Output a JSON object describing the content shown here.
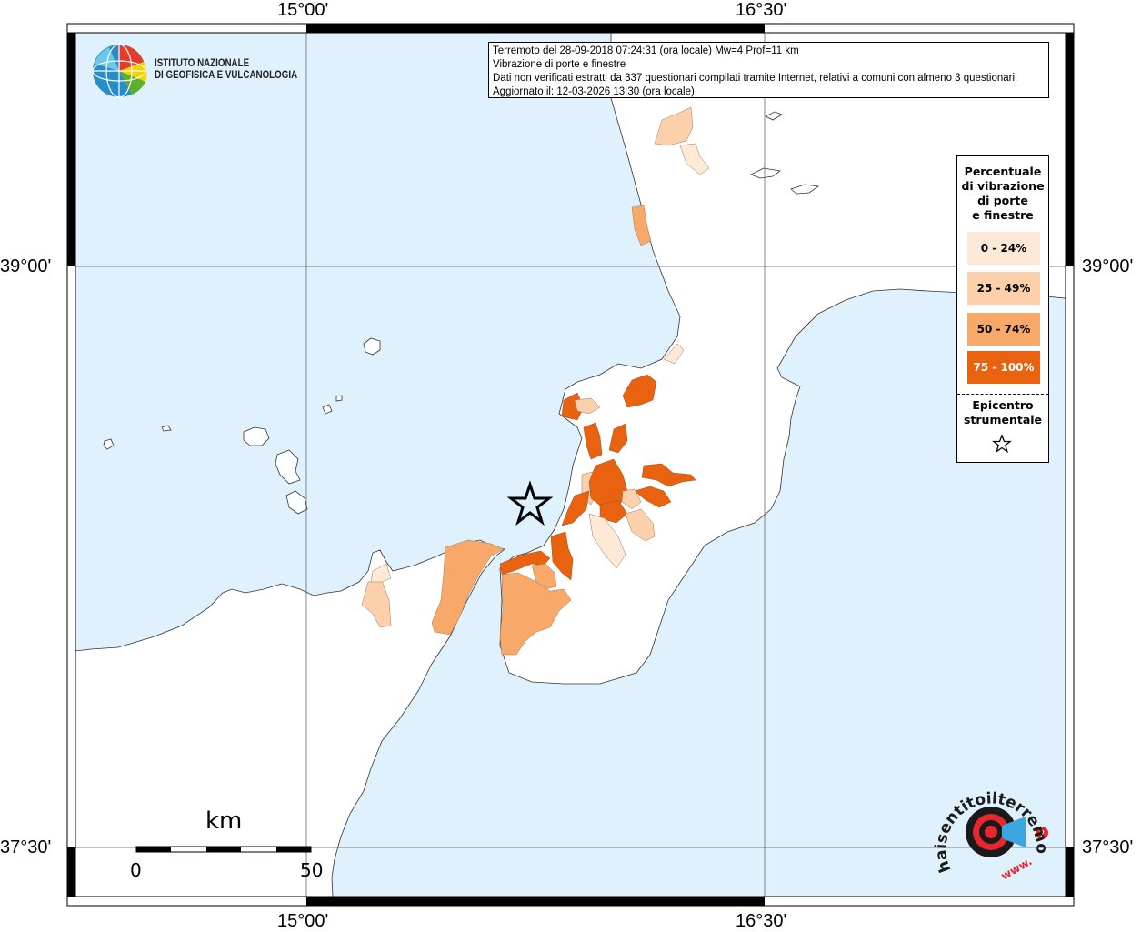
{
  "map": {
    "coords": {
      "top_left": "15°00'",
      "top_right": "16°30'",
      "bottom_left": "15°00'",
      "bottom_right": "16°30'",
      "left_upper": "39°00'",
      "left_lower": "37°30'",
      "right_upper": "39°00'",
      "right_lower": "37°30'"
    },
    "colors": {
      "sea": "#dff1fd",
      "land": "#ffffff",
      "class_0_24": "#fde9d6",
      "class_25_49": "#fbd0aa",
      "class_50_74": "#f8a868",
      "class_75_100": "#e8620f"
    }
  },
  "info": {
    "line1": "Terremoto del 28-09-2018 07:24:31 (ora locale) Mw=4 Prof=11 km",
    "line2": "Vibrazione di porte e finestre",
    "line3": "Dati non verificati estratti da 337 questionari compilati tramite Internet, relativi a comuni con almeno 3 questionari.",
    "line4": "Aggiornato il: 12-03-2026 13:30 (ora locale)"
  },
  "legend": {
    "title_lines": [
      "Percentuale",
      "di vibrazione",
      "di porte",
      "e finestre"
    ],
    "items": [
      "0 - 24%",
      "25 - 49%",
      "50 - 74%",
      "75 - 100%"
    ],
    "epicenter_lines": [
      "Epicentro",
      "strumentale"
    ]
  },
  "logo": {
    "lines": [
      "ISTITUTO NAZIONALE",
      "DI GEOFISICA E VULCANOLOGIA"
    ]
  },
  "scale": {
    "label": "km",
    "min": "0",
    "max": "50"
  },
  "hst_logo": {
    "text": "haisentitoilterremoto.it",
    "url_text": "www."
  }
}
